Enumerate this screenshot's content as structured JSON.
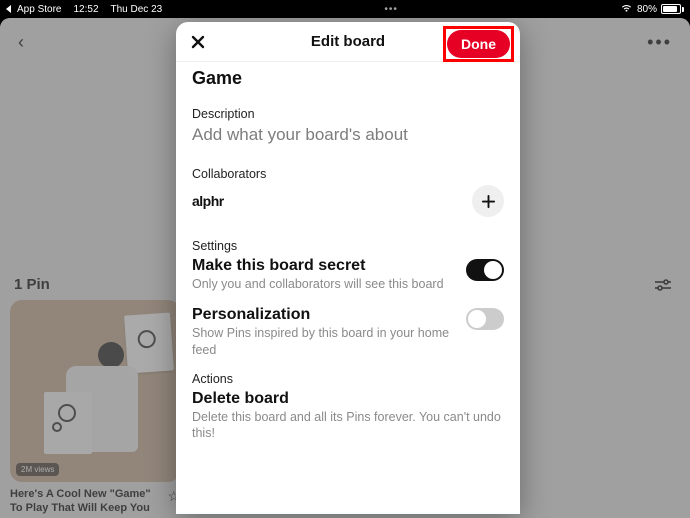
{
  "statusbar": {
    "back_app": "App Store",
    "time": "12:52",
    "date": "Thu Dec 23",
    "center_dots": "•••",
    "battery_pct": "80%"
  },
  "background": {
    "pin_count": "1 Pin",
    "card_views": "2M views",
    "card_caption": "Here's A Cool New \"Game\" To Play That Will Keep You"
  },
  "modal": {
    "title": "Edit board",
    "done_label": "Done",
    "board_name": "Game",
    "description": {
      "label": "Description",
      "placeholder": "Add what your board's about"
    },
    "collaborators": {
      "label": "Collaborators",
      "user": "alphr"
    },
    "settings": {
      "label": "Settings",
      "secret": {
        "title": "Make this board secret",
        "sub": "Only you and collaborators will see this board",
        "on": true
      },
      "personalization": {
        "title": "Personalization",
        "sub": "Show Pins inspired by this board in your home feed",
        "on": false
      }
    },
    "actions": {
      "label": "Actions",
      "delete": {
        "title": "Delete board",
        "sub": "Delete this board and all its Pins forever. You can't undo this!"
      }
    }
  }
}
